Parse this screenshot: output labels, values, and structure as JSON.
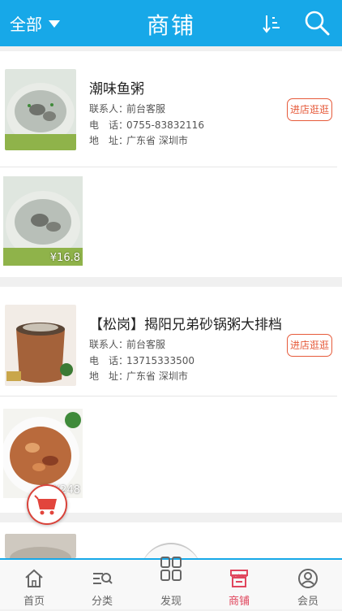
{
  "header": {
    "filter_label": "全部",
    "title": "商铺",
    "icons": {
      "filter_dropdown": "triangle-down-icon",
      "sort": "sort-icon",
      "search": "search-icon"
    }
  },
  "shops": [
    {
      "name": "潮味鱼粥",
      "contact_key": "联系人：",
      "contact_value": "前台客服",
      "phone_key": "电　话：",
      "phone_value": "0755-83832116",
      "address_key": "地　址：",
      "address_value": "广东省 深圳市",
      "visit_label": "进店逛逛",
      "product_price": "¥16.8"
    },
    {
      "name": "【松岗】揭阳兄弟砂锅粥大排档",
      "contact_key": "联系人：",
      "contact_value": "前台客服",
      "phone_key": "电　话：",
      "phone_value": "13715333500",
      "address_key": "地　址：",
      "address_value": "广东省 深圳市",
      "visit_label": "进店逛逛",
      "product_price": "¥248"
    }
  ],
  "tabbar": {
    "items": [
      {
        "label": "首页",
        "icon": "home-icon"
      },
      {
        "label": "分类",
        "icon": "category-icon"
      },
      {
        "label": "发现",
        "icon": "grid-icon"
      },
      {
        "label": "商铺",
        "icon": "shop-icon",
        "active": true
      },
      {
        "label": "会员",
        "icon": "user-icon"
      }
    ]
  },
  "colors": {
    "brand": "#17a8e8",
    "accent": "#e65a3a",
    "active_tab": "#e0465d"
  }
}
